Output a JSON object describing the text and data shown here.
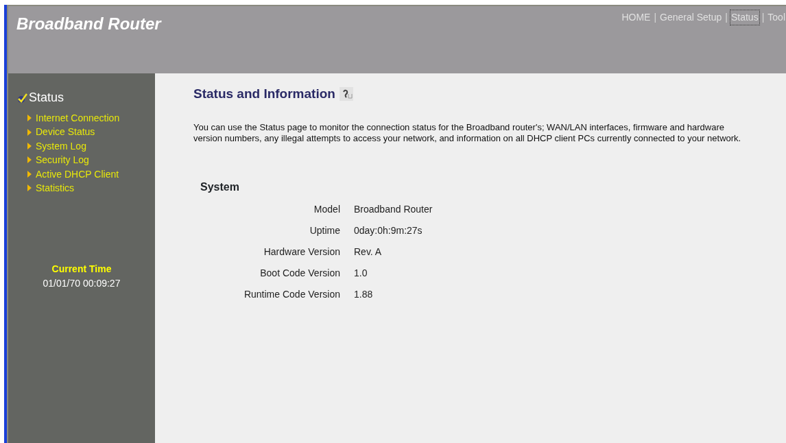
{
  "header": {
    "title": "Broadband Router",
    "nav": {
      "separator": "|",
      "items": [
        {
          "label": "HOME",
          "selected": false
        },
        {
          "label": "General Setup",
          "selected": false
        },
        {
          "label": "Status",
          "selected": true
        },
        {
          "label": "Tool",
          "selected": false
        }
      ]
    }
  },
  "sidebar": {
    "section": "Status",
    "items": [
      {
        "label": "Internet Connection"
      },
      {
        "label": "Device Status"
      },
      {
        "label": "System Log"
      },
      {
        "label": "Security Log"
      },
      {
        "label": "Active DHCP Client"
      },
      {
        "label": "Statistics"
      }
    ],
    "time_label": "Current Time",
    "time_value": "01/01/70 00:09:27"
  },
  "content": {
    "title": "Status and Information",
    "description": "You can use the Status page to monitor the connection status for the Broadband router's; WAN/LAN interfaces, firmware and hardware version numbers, any illegal attempts to access your network, and information on all DHCP client PCs currently connected to your network.",
    "section": "System",
    "rows": [
      {
        "label": "Model",
        "value": "Broadband Router"
      },
      {
        "label": "Uptime",
        "value": "0day:0h:9m:27s"
      },
      {
        "label": "Hardware Version",
        "value": "Rev. A"
      },
      {
        "label": "Boot Code Version",
        "value": "1.0"
      },
      {
        "label": "Runtime Code Version",
        "value": "1.88"
      }
    ]
  }
}
